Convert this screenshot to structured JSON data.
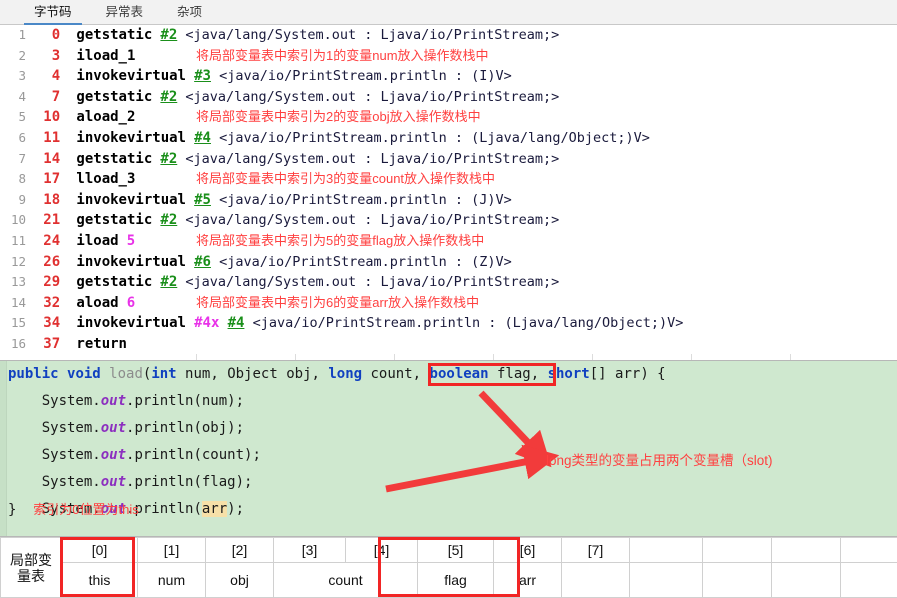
{
  "tabs": [
    {
      "label": "字节码",
      "active": true
    },
    {
      "label": "异常表",
      "active": false
    },
    {
      "label": "杂项",
      "active": false
    }
  ],
  "bytecode": {
    "rows": [
      {
        "line": "1",
        "offset": "0",
        "op": "getstatic",
        "arg": "",
        "ref": "#2",
        "desc": "<java/lang/System.out : Ljava/io/PrintStream;>",
        "note": ""
      },
      {
        "line": "2",
        "offset": "3",
        "op": "iload_1",
        "arg": "",
        "ref": "",
        "desc": "",
        "note": "将局部变量表中索引为1的变量num放入操作数栈中"
      },
      {
        "line": "3",
        "offset": "4",
        "op": "invokevirtual",
        "arg": "",
        "ref": "#3",
        "desc": "<java/io/PrintStream.println : (I)V>",
        "note": ""
      },
      {
        "line": "4",
        "offset": "7",
        "op": "getstatic",
        "arg": "",
        "ref": "#2",
        "desc": "<java/lang/System.out : Ljava/io/PrintStream;>",
        "note": ""
      },
      {
        "line": "5",
        "offset": "10",
        "op": "aload_2",
        "arg": "",
        "ref": "",
        "desc": "",
        "note": "将局部变量表中索引为2的变量obj放入操作数栈中"
      },
      {
        "line": "6",
        "offset": "11",
        "op": "invokevirtual",
        "arg": "",
        "ref": "#4",
        "desc": "<java/io/PrintStream.println : (Ljava/lang/Object;)V>",
        "note": ""
      },
      {
        "line": "7",
        "offset": "14",
        "op": "getstatic",
        "arg": "",
        "ref": "#2",
        "desc": "<java/lang/System.out : Ljava/io/PrintStream;>",
        "note": ""
      },
      {
        "line": "8",
        "offset": "17",
        "op": "lload_3",
        "arg": "",
        "ref": "",
        "desc": "",
        "note": "将局部变量表中索引为3的变量count放入操作数栈中"
      },
      {
        "line": "9",
        "offset": "18",
        "op": "invokevirtual",
        "arg": "",
        "ref": "#5",
        "desc": "<java/io/PrintStream.println : (J)V>",
        "note": ""
      },
      {
        "line": "10",
        "offset": "21",
        "op": "getstatic",
        "arg": "",
        "ref": "#2",
        "desc": "<java/lang/System.out : Ljava/io/PrintStream;>",
        "note": ""
      },
      {
        "line": "11",
        "offset": "24",
        "op": "iload",
        "arg": "5",
        "ref": "",
        "desc": "",
        "note": "将局部变量表中索引为5的变量flag放入操作数栈中"
      },
      {
        "line": "12",
        "offset": "26",
        "op": "invokevirtual",
        "arg": "",
        "ref": "#6",
        "desc": "<java/io/PrintStream.println : (Z)V>",
        "note": ""
      },
      {
        "line": "13",
        "offset": "29",
        "op": "getstatic",
        "arg": "",
        "ref": "#2",
        "desc": "<java/lang/System.out : Ljava/io/PrintStream;>",
        "note": ""
      },
      {
        "line": "14",
        "offset": "32",
        "op": "aload",
        "arg": "6",
        "ref": "",
        "desc": "",
        "note": "将局部变量表中索引为6的变量arr放入操作数栈中"
      },
      {
        "line": "15",
        "offset": "34",
        "op": "invokevirtual",
        "arg": "#4x",
        "ref": "#4",
        "desc": "<java/io/PrintStream.println : (Ljava/lang/Object;)V>",
        "note": ""
      },
      {
        "line": "16",
        "offset": "37",
        "op": "return",
        "arg": "",
        "ref": "",
        "desc": "",
        "note": ""
      }
    ]
  },
  "source": {
    "signature": {
      "kw_public": "public",
      "kw_void": "void",
      "method_name": "load",
      "open_paren": "(",
      "p1_type": "int",
      "p1_name": " num, ",
      "p2_type": "Object",
      "p2_name": " obj, ",
      "p3_type": "long",
      "p3_name": " count,",
      "p4_type": "boolean",
      "p4_name": " flag, ",
      "p5_type": "short",
      "p5_array": "[] ",
      "p5_name": "arr",
      "close": ") {"
    },
    "body": [
      {
        "pre": "    System.",
        "field": "out",
        "post": ".println(num);",
        "hl": ""
      },
      {
        "pre": "    System.",
        "field": "out",
        "post": ".println(obj);",
        "hl": ""
      },
      {
        "pre": "    System.",
        "field": "out",
        "post": ".println(count);",
        "hl": ""
      },
      {
        "pre": "    System.",
        "field": "out",
        "post": ".println(flag);",
        "hl": ""
      },
      {
        "pre": "    System.",
        "field": "out",
        "post": ".println(",
        "hl": "arr",
        "tail": ");"
      }
    ],
    "close_brace": "}",
    "close_note": "索引为0位置为this",
    "slot_note": "long类型的变量占用两个变量槽（slot)"
  },
  "slot_table": {
    "row_label": "局部变\n量表",
    "indices": [
      "[0]",
      "[1]",
      "[2]",
      "[3]",
      "[4]",
      "[5]",
      "[6]",
      "[7]",
      "",
      "",
      "",
      "",
      ""
    ],
    "values": [
      "this",
      "num",
      "obj",
      "count",
      "flag",
      "arr",
      "",
      "",
      "",
      "",
      "",
      ""
    ]
  },
  "colors": {
    "annotation_red": "#ff4040",
    "box_red": "#f12525",
    "source_bg": "#cfe8cf",
    "offset_red": "#e03030",
    "const_ref_green": "#1a8f1a",
    "number_magenta": "#e832e8",
    "keyword_blue": "#1040c0",
    "tab_accent": "#4a88c7"
  }
}
